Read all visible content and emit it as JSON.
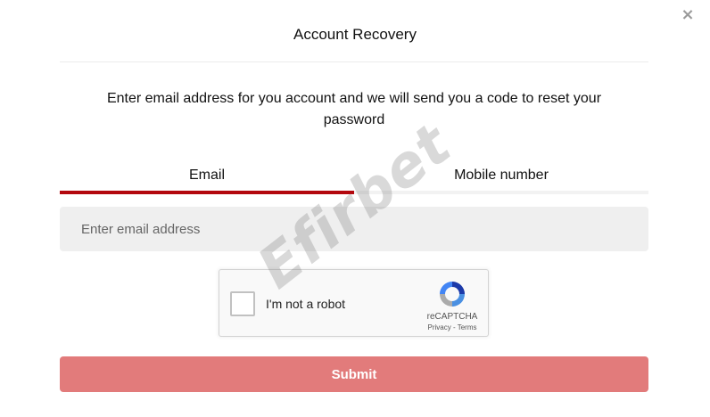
{
  "modal": {
    "close_symbol": "×",
    "title": "Account Recovery",
    "instructions": "Enter email address for you account and we will send you a code to reset your password"
  },
  "tabs": [
    {
      "label": "Email",
      "active": true
    },
    {
      "label": "Mobile number",
      "active": false
    }
  ],
  "email_field": {
    "value": "",
    "placeholder": "Enter email address"
  },
  "captcha": {
    "label": "I'm not a robot",
    "brand": "reCAPTCHA",
    "privacy_link": "Privacy",
    "separator": " - ",
    "terms_link": "Terms",
    "checked": false
  },
  "submit": {
    "label": "Submit"
  },
  "watermark": {
    "text": "Efirbet"
  },
  "colors": {
    "accent_red": "#b3080e",
    "submit_disabled": "#e27b7b",
    "input_bg": "#efefef",
    "inactive_tab_line": "#f2f2f2"
  },
  "icons": {
    "close": "close-icon",
    "captcha_logo": "recaptcha-logo-icon",
    "checkbox": "checkbox-icon"
  }
}
